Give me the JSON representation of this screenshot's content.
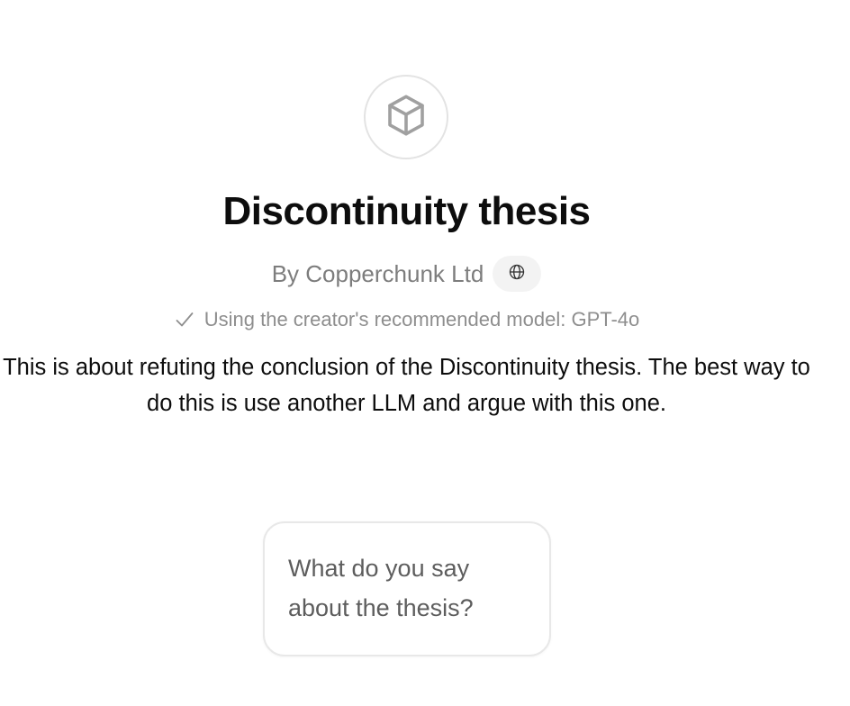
{
  "gpt": {
    "avatar_icon": "cube-icon",
    "title": "Discontinuity thesis",
    "author": "By Copperchunk Ltd",
    "website_icon": "globe-icon",
    "recommended_model": "Using the creator's recommended model: GPT-4o",
    "description": "This is about refuting the conclusion of the Discontinuity thesis. The best way to do this is use another LLM and argue with this one."
  },
  "conversation_starters": [
    {
      "label": "What do you say about the thesis?"
    }
  ],
  "colors": {
    "title": "#0d0d0d",
    "muted": "#7d7d7d",
    "border": "#e3e3e3",
    "pill_bg": "#f3f3f3"
  }
}
